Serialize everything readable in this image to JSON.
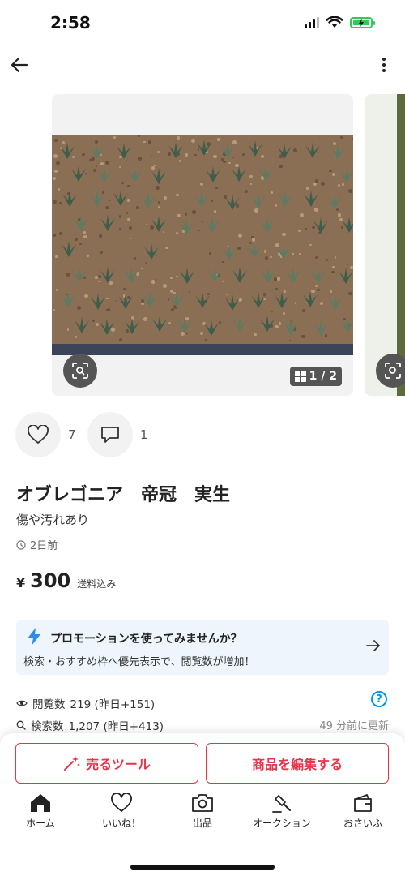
{
  "status": {
    "time": "2:58"
  },
  "carousel": {
    "page": "1 / 2"
  },
  "actions": {
    "likes": "7",
    "comments": "1"
  },
  "item": {
    "title": "オブレゴニア　帝冠　実生",
    "condition": "傷や汚れあり",
    "posted": "2日前",
    "price_symbol": "¥",
    "price": "300",
    "shipping": "送料込み"
  },
  "promo": {
    "title": "プロモーションを使ってみませんか？",
    "description": "検索・おすすめ枠へ優先表示で、閲覧数が増加！"
  },
  "stats": {
    "views_label": "閲覧数",
    "views_value": "219 (昨日+151)",
    "search_label": "検索数",
    "search_value": "1,207 (昨日+413)",
    "updated": "49 分前に更新"
  },
  "buttons": {
    "sell_tool": "売るツール",
    "edit": "商品を編集する"
  },
  "nav": {
    "home": "ホーム",
    "likes": "いいね！",
    "listing": "出品",
    "auction": "オークション",
    "wallet": "おさいふ"
  },
  "colors": {
    "accent": "#e8334a",
    "promo_bg": "#eef5fc",
    "info_blue": "#0095ee"
  }
}
